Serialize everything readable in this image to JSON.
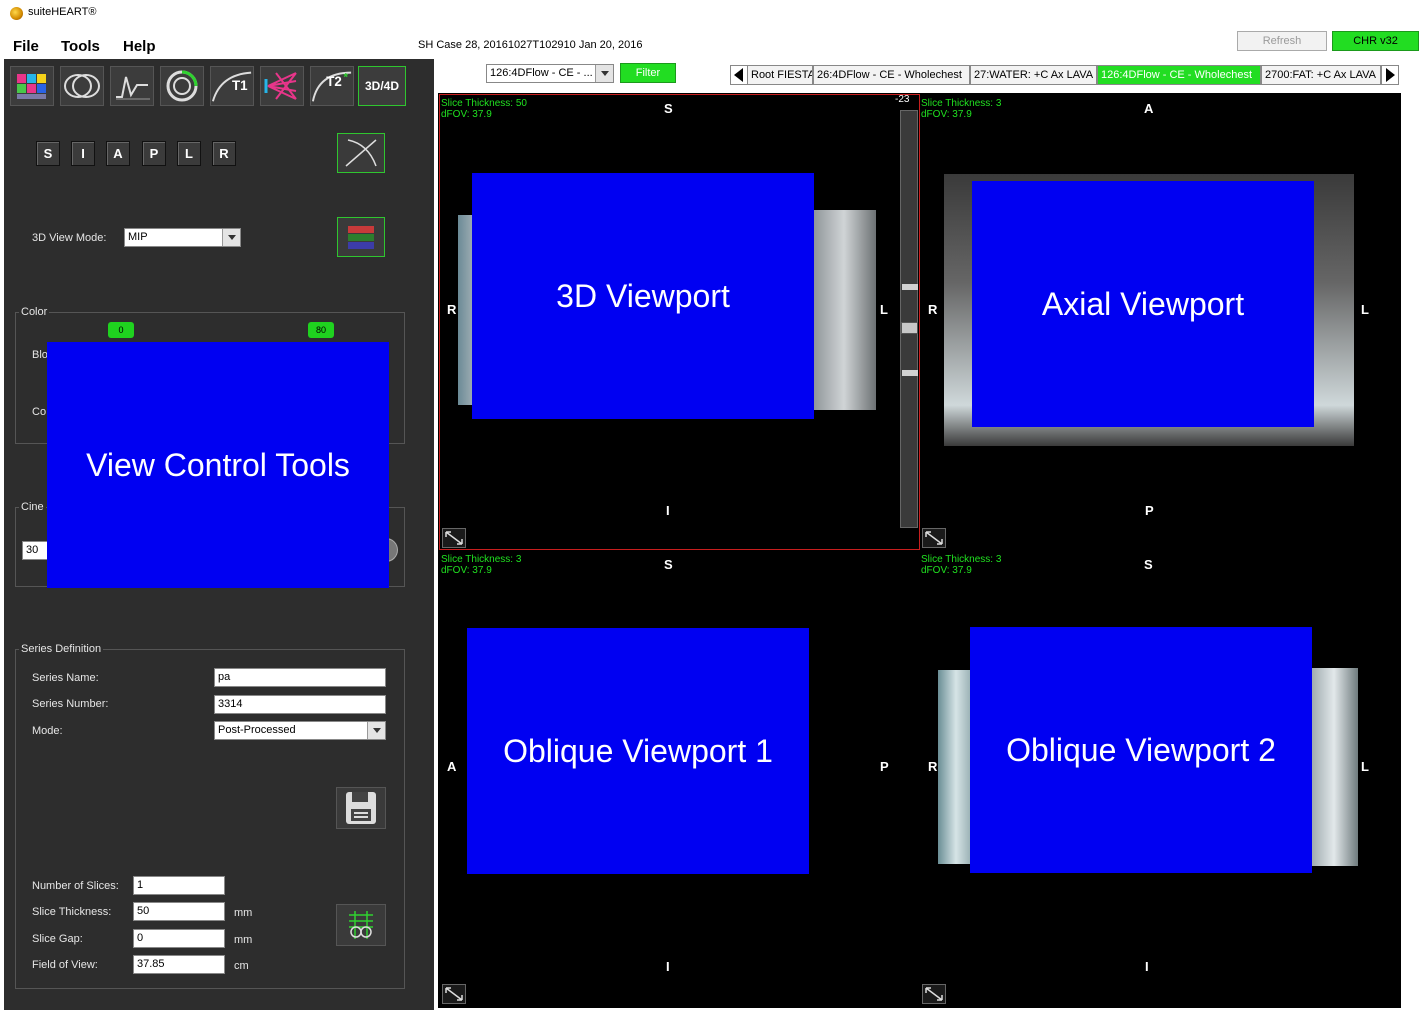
{
  "app": {
    "title": "suiteHEART®"
  },
  "menu": {
    "file": "File",
    "tools": "Tools",
    "help": "Help"
  },
  "case_info": "SH Case 28, 20161027T102910   Jan 20, 2016",
  "buttons": {
    "refresh": "Refresh",
    "version": "CHR v32"
  },
  "toolbar": {
    "icons": [
      "multi-color-grid-icon",
      "contour-icon",
      "graph-icon",
      "ring-icon",
      "t1-curve-icon",
      "perfusion-icon",
      "t2-curve-icon",
      "3d4d-icon"
    ],
    "t1_label": "T1",
    "t2_label": "T2",
    "t2_suffix": "*",
    "mode_3d4d": "3D/4D"
  },
  "orientation_buttons": [
    "S",
    "I",
    "A",
    "P",
    "L",
    "R"
  ],
  "view_mode": {
    "label": "3D View Mode:",
    "value": "MIP"
  },
  "color": {
    "group_label": "Color",
    "slider_min": "0",
    "slider_max": "80",
    "row1": "Blo",
    "row2": "Co"
  },
  "cine": {
    "group_label": "Cine",
    "value": "30"
  },
  "overlay_left": "View Control Tools",
  "series_definition": {
    "group_label": "Series Definition",
    "name_label": "Series Name:",
    "name_value": "pa",
    "number_label": "Series Number:",
    "number_value": "3314",
    "mode_label": "Mode:",
    "mode_value": "Post-Processed"
  },
  "slice_params": {
    "num_slices_label": "Number of Slices:",
    "num_slices": "1",
    "thickness_label": "Slice Thickness:",
    "thickness": "50",
    "thickness_unit": "mm",
    "gap_label": "Slice Gap:",
    "gap": "0",
    "gap_unit": "mm",
    "fov_label": "Field of View:",
    "fov": "37.85",
    "fov_unit": "cm"
  },
  "series_select": {
    "value": "126:4DFlow - CE - ...",
    "filter": "Filter"
  },
  "series_tabs": [
    "Root FIESTA",
    "26:4DFlow - CE - Wholechest",
    "27:WATER: +C Ax LAVA",
    "126:4DFlow - CE - Wholechest",
    "2700:FAT: +C Ax LAVA"
  ],
  "active_tab_index": 3,
  "viewports": {
    "vp1": {
      "thickness": "Slice Thickness: 50",
      "fov": "dFOV: 37.9",
      "top": "S",
      "bottom": "I",
      "left": "R",
      "right": "L",
      "overlay": "3D Viewport",
      "scroll_value": "-23"
    },
    "vp2": {
      "thickness": "Slice Thickness: 3",
      "fov": "dFOV: 37.9",
      "top": "A",
      "bottom": "P",
      "left": "R",
      "right": "L",
      "overlay": "Axial Viewport"
    },
    "vp3": {
      "thickness": "Slice Thickness: 3",
      "fov": "dFOV: 37.9",
      "top": "S",
      "bottom": "I",
      "left": "A",
      "right": "P",
      "overlay": "Oblique Viewport 1"
    },
    "vp4": {
      "thickness": "Slice Thickness: 3",
      "fov": "dFOV: 37.9",
      "top": "S",
      "bottom": "I",
      "left": "R",
      "right": "L",
      "overlay": "Oblique Viewport 2"
    }
  }
}
